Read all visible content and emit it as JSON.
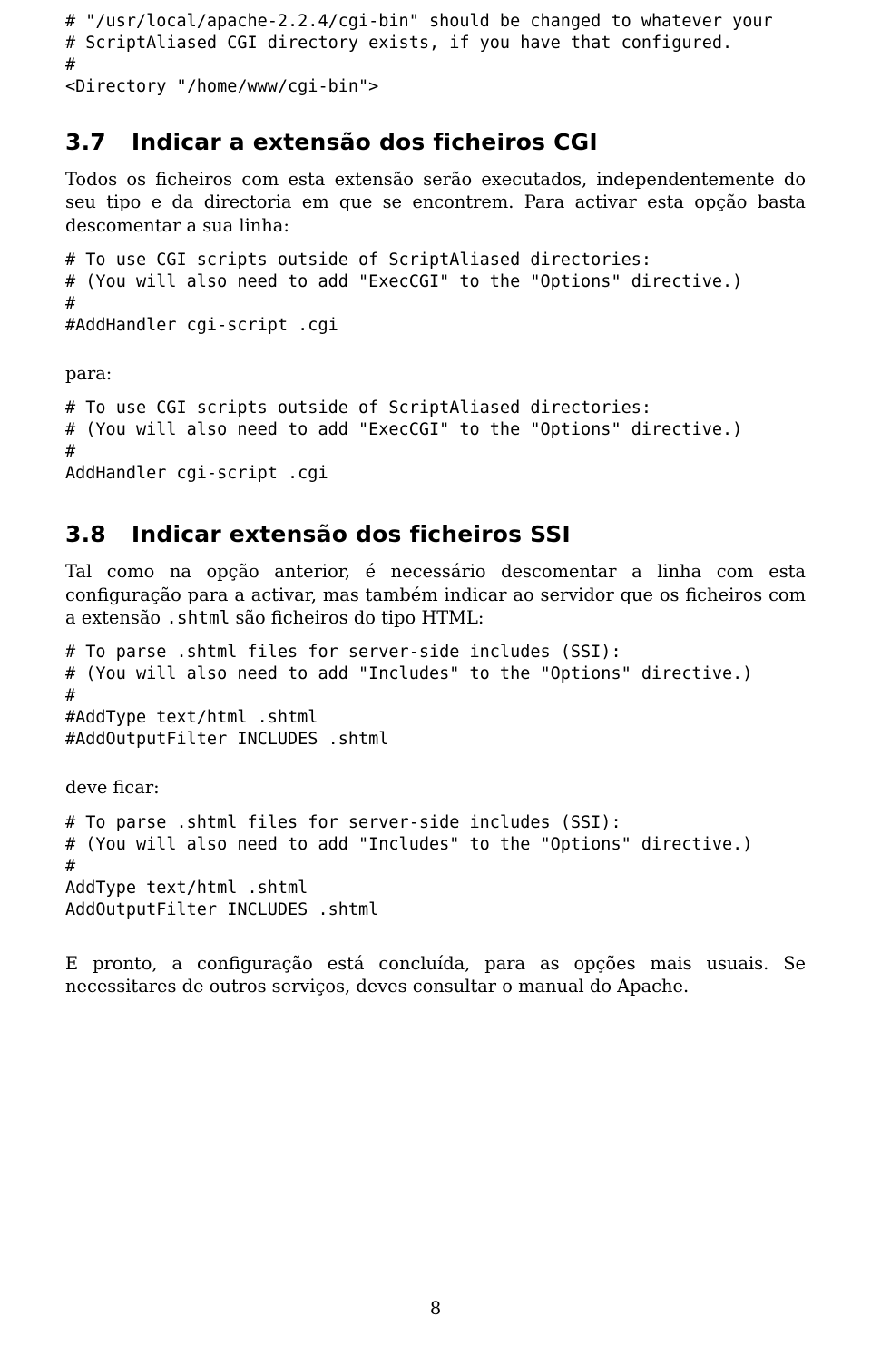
{
  "code": {
    "block0": "# \"/usr/local/apache-2.2.4/cgi-bin\" should be changed to whatever your\n# ScriptAliased CGI directory exists, if you have that configured.\n#\n<Directory \"/home/www/cgi-bin\">",
    "block1": "# To use CGI scripts outside of ScriptAliased directories:\n# (You will also need to add \"ExecCGI\" to the \"Options\" directive.)\n#\n#AddHandler cgi-script .cgi",
    "block2": "# To use CGI scripts outside of ScriptAliased directories:\n# (You will also need to add \"ExecCGI\" to the \"Options\" directive.)\n#\nAddHandler cgi-script .cgi",
    "block3": "# To parse .shtml files for server-side includes (SSI):\n# (You will also need to add \"Includes\" to the \"Options\" directive.)\n#\n#AddType text/html .shtml\n#AddOutputFilter INCLUDES .shtml",
    "block4": "# To parse .shtml files for server-side includes (SSI):\n# (You will also need to add \"Includes\" to the \"Options\" directive.)\n#\nAddType text/html .shtml\nAddOutputFilter INCLUDES .shtml"
  },
  "sec37": {
    "num": "3.7",
    "title": "Indicar a extensão dos ficheiros CGI",
    "para": "Todos os ficheiros com esta extensão serão executados, independentemente do seu tipo e da directoria em que se encontrem. Para activar esta opção basta descomentar a sua linha:",
    "para_label": "para:"
  },
  "sec38": {
    "num": "3.8",
    "title": "Indicar extensão dos ficheiros SSI",
    "para_pre": "Tal como na opção anterior, é necessário descomentar a linha com esta configuração para a activar, mas também indicar ao servidor que os ficheiros com a extensão ",
    "mono": ".shtml",
    "para_post": " são ficheiros do tipo HTML:",
    "deve_ficar": "deve ficar:",
    "closing": "E pronto, a configuração está concluída, para as opções mais usuais. Se necessitares de outros serviços, deves consultar o manual do Apache."
  },
  "page_number": "8"
}
